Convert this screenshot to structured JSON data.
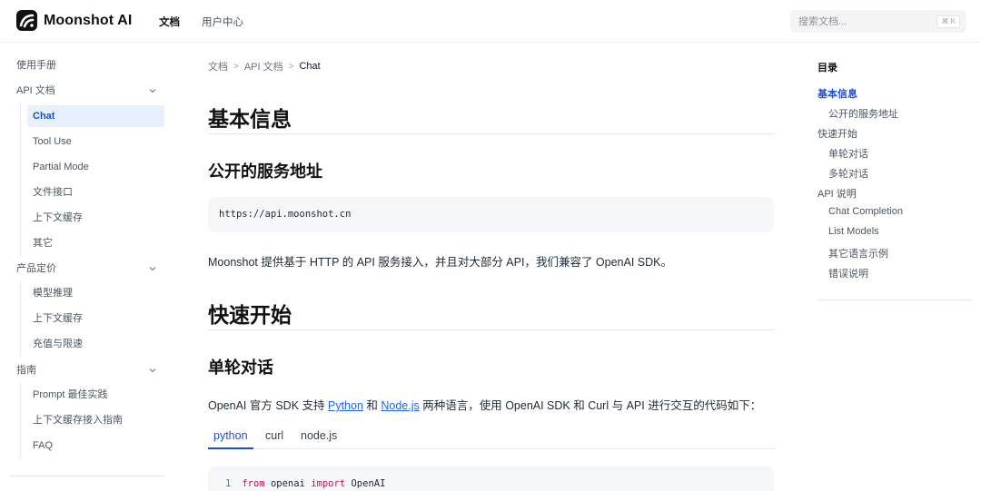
{
  "header": {
    "brand": "Moonshot AI",
    "nav": [
      {
        "label": "文档",
        "active": true
      },
      {
        "label": "用户中心",
        "active": false
      }
    ],
    "search": {
      "placeholder": "搜索文档...",
      "shortcut": "⌘ K"
    }
  },
  "sidebar": {
    "groups": [
      {
        "label": "使用手册",
        "collapsible": false
      },
      {
        "label": "API 文档",
        "collapsible": true
      },
      {
        "label": "产品定价",
        "collapsible": true
      },
      {
        "label": "指南",
        "collapsible": true
      }
    ],
    "api_items": [
      "Chat",
      "Tool Use",
      "Partial Mode",
      "文件接口",
      "上下文缓存",
      "其它"
    ],
    "pricing_items": [
      "模型推理",
      "上下文缓存",
      "充值与限速"
    ],
    "guide_items": [
      "Prompt 最佳实践",
      "上下文缓存接入指南",
      "FAQ"
    ],
    "active_item": "Chat"
  },
  "breadcrumb": {
    "items": [
      "文档",
      "API 文档",
      "Chat"
    ],
    "separator": ">"
  },
  "content": {
    "h1_basic": "基本信息",
    "h2_public_url": "公开的服务地址",
    "url": "https://api.moonshot.cn",
    "intro": "Moonshot 提供基于 HTTP 的 API 服务接入，并且对大部分 API，我们兼容了 OpenAI SDK。",
    "h1_quickstart": "快速开始",
    "h2_single_turn": "单轮对话",
    "sdk_para": {
      "before": "OpenAI 官方 SDK 支持 ",
      "link1": "Python",
      "mid": " 和 ",
      "link2": "Node.js",
      "after": " 两种语言，使用 OpenAI SDK 和 Curl 与 API 进行交互的代码如下："
    },
    "tabs": [
      "python",
      "curl",
      "node.js"
    ],
    "active_tab": "python",
    "code_line": {
      "number": "1",
      "kw1": "from",
      "module": "openai",
      "kw2": "import",
      "name": "OpenAI"
    }
  },
  "toc": {
    "title": "目录",
    "items": [
      {
        "label": "基本信息",
        "level": 1,
        "active": true
      },
      {
        "label": "公开的服务地址",
        "level": 2
      },
      {
        "label": "快速开始",
        "level": 1
      },
      {
        "label": "单轮对话",
        "level": 2
      },
      {
        "label": "多轮对话",
        "level": 2
      },
      {
        "label": "API 说明",
        "level": 1
      },
      {
        "label": "Chat Completion",
        "level": 2
      },
      {
        "label": "List Models",
        "level": 2
      },
      {
        "label": "其它语言示例",
        "level": 2
      },
      {
        "label": "错误说明",
        "level": 2
      }
    ]
  },
  "colors": {
    "accent": "#1d4ed8",
    "active_bg": "#e8f0fe",
    "keyword": "#c2185b"
  }
}
